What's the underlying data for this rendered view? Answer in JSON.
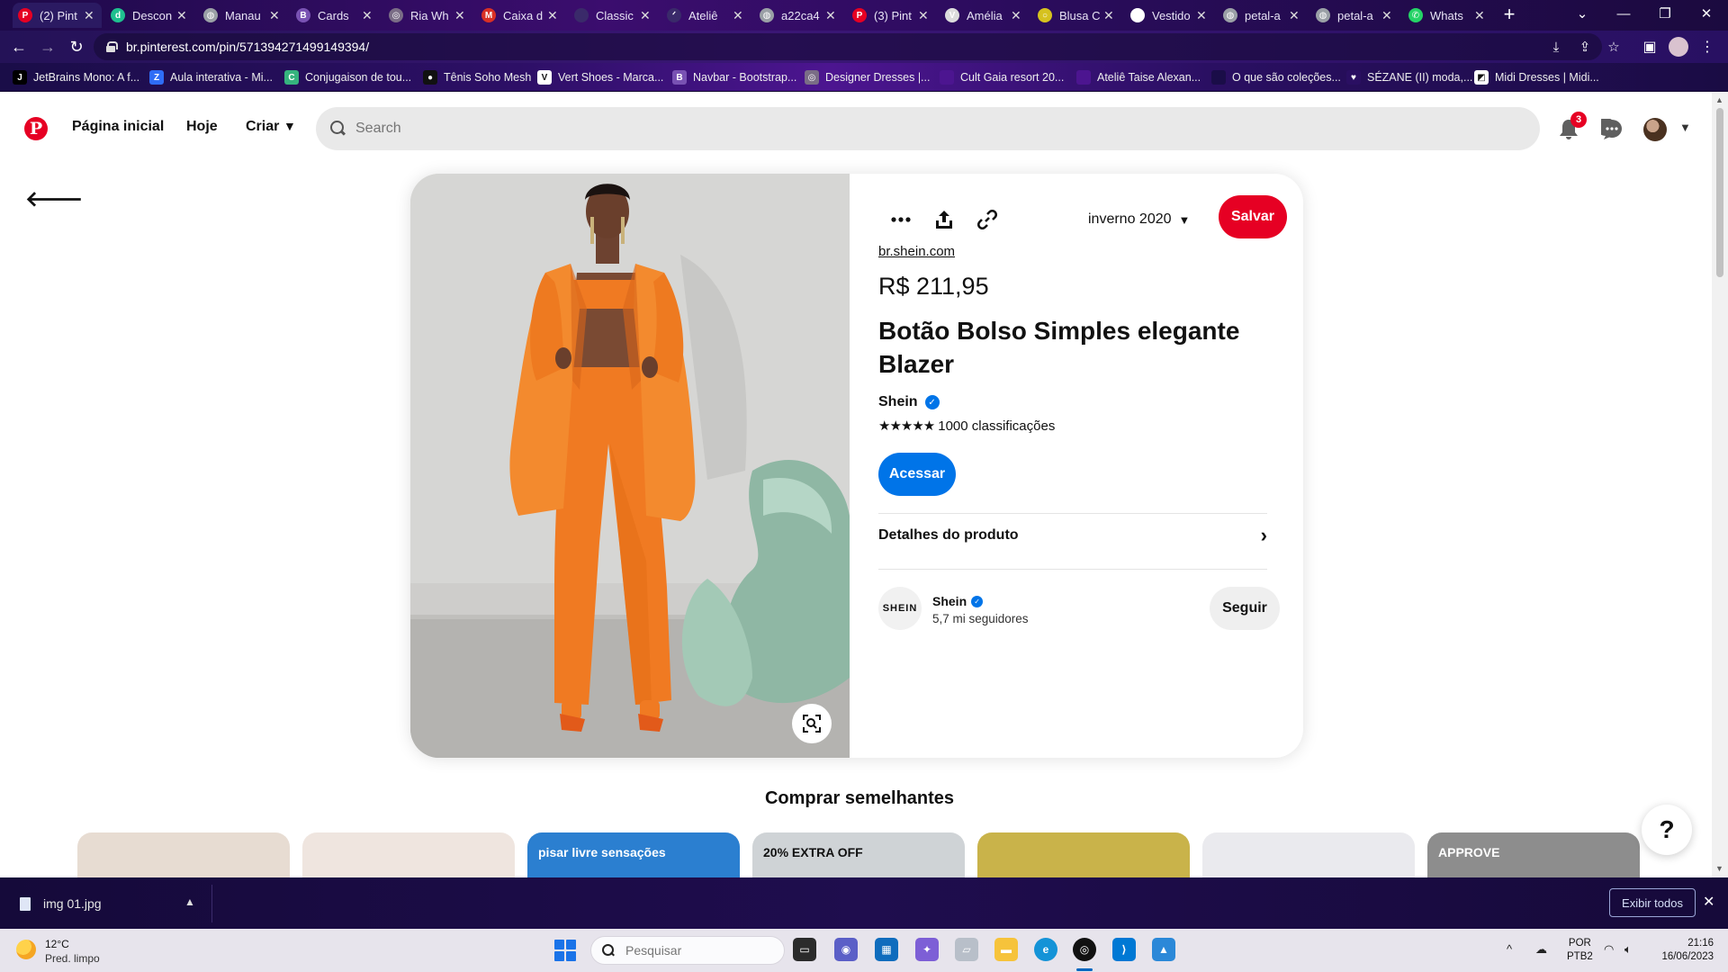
{
  "browser": {
    "tabs": [
      {
        "title": "(2) Pint",
        "favicon": "pinterest-icon",
        "color": "#e60023",
        "glyph": "P",
        "active": true
      },
      {
        "title": "Descon",
        "favicon": "descomplica-icon",
        "color": "#1fbf8f",
        "glyph": "d"
      },
      {
        "title": "Manau",
        "favicon": "globe-icon",
        "color": "#9aa0a6",
        "glyph": "◍"
      },
      {
        "title": "Cards",
        "favicon": "bootstrap-icon",
        "color": "#7952b3",
        "glyph": "B"
      },
      {
        "title": "Ria Wh",
        "favicon": "dribbble-icon",
        "color": "#7a6d86",
        "glyph": "◎"
      },
      {
        "title": "Caixa d",
        "favicon": "gmail-icon",
        "color": "#d93025",
        "glyph": "M"
      },
      {
        "title": "Classic",
        "favicon": "blank-icon",
        "color": "#3a2a6a",
        "glyph": ""
      },
      {
        "title": "Ateliê",
        "favicon": "atelie-icon",
        "color": "#3a2a6a",
        "glyph": "ᐟ"
      },
      {
        "title": "a22ca4",
        "favicon": "globe-icon",
        "color": "#9aa0a6",
        "glyph": "◍"
      },
      {
        "title": "(3) Pint",
        "favicon": "pinterest-icon",
        "color": "#e60023",
        "glyph": "P"
      },
      {
        "title": "Amélia",
        "favicon": "amelia-icon",
        "color": "#dcdcdc",
        "glyph": "V"
      },
      {
        "title": "Blusa C",
        "favicon": "circle-icon",
        "color": "#d6c21f",
        "glyph": "○"
      },
      {
        "title": "Vestido",
        "favicon": "image-icon",
        "color": "#ffffff",
        "glyph": "◩"
      },
      {
        "title": "petal-a",
        "favicon": "globe-icon",
        "color": "#9aa0a6",
        "glyph": "◍"
      },
      {
        "title": "petal-a",
        "favicon": "globe-icon",
        "color": "#9aa0a6",
        "glyph": "◍"
      },
      {
        "title": "Whats",
        "favicon": "whatsapp-icon",
        "color": "#25d366",
        "glyph": "✆"
      }
    ],
    "url": "br.pinterest.com/pin/571394271499149394/",
    "bookmarks": [
      {
        "label": "JetBrains Mono: A f...",
        "color": "#000000",
        "glyph": "J"
      },
      {
        "label": "Aula interativa - Mi...",
        "color": "#2f6df6",
        "glyph": "Z"
      },
      {
        "label": "Conjugaison de tou...",
        "color": "#36b37e",
        "glyph": "C"
      },
      {
        "label": "Tênis Soho Mesh",
        "color": "#111111",
        "glyph": "●"
      },
      {
        "label": "Vert Shoes - Marca...",
        "color": "#ffffff",
        "glyph": "V"
      },
      {
        "label": "Navbar - Bootstrap...",
        "color": "#7952b3",
        "glyph": "B"
      },
      {
        "label": "Designer Dresses |...",
        "color": "#7a6d86",
        "glyph": "◎"
      },
      {
        "label": "Cult Gaia resort 20...",
        "color": "#4c1590",
        "glyph": ""
      },
      {
        "label": "Ateliê Taise Alexan...",
        "color": "#4c1590",
        "glyph": ""
      },
      {
        "label": "O que são coleções...",
        "color": "#1a0d48",
        "glyph": ""
      },
      {
        "label": "SÉZANE (II) moda,...",
        "color": "#2a0f62",
        "glyph": "♥"
      },
      {
        "label": "Midi Dresses | Midi...",
        "color": "#ffffff",
        "glyph": "◩"
      }
    ]
  },
  "header": {
    "nav": [
      "Página inicial",
      "Hoje",
      "Criar"
    ],
    "search_placeholder": "Search",
    "notifications_count": "3"
  },
  "pin": {
    "board": "inverno 2020",
    "save_label": "Salvar",
    "domain": "br.shein.com",
    "price": "R$ 211,95",
    "title": "Botão Bolso Simples elegante Blazer",
    "brand": "Shein",
    "rating_stars": "★★★★★",
    "rating_count": "1000 classificações",
    "visit_label": "Acessar",
    "details_label": "Detalhes do produto",
    "creator": {
      "avatar_text": "SHEIN",
      "name": "Shein",
      "followers": "5,7 mi seguidores",
      "follow_label": "Seguir"
    }
  },
  "shop": {
    "title": "Comprar semelhantes",
    "cards": [
      {
        "overlay": "",
        "bg": "#e7dcd2"
      },
      {
        "overlay": "",
        "bg": "#efe5df"
      },
      {
        "overlay": "pisar livre sensações",
        "bg": "#2b7fd0"
      },
      {
        "overlay": "20% EXTRA OFF",
        "bg": "#cfd3d6"
      },
      {
        "overlay": "",
        "bg": "#c9b34a"
      },
      {
        "overlay": "",
        "bg": "#eaeaee"
      },
      {
        "overlay": "APPROVE",
        "bg": "#8d8d8d"
      }
    ],
    "help_label": "?"
  },
  "downloads": {
    "file": "img 01.jpg",
    "show_all": "Exibir todos"
  },
  "taskbar": {
    "temperature": "12°C",
    "weather": "Pred. limpo",
    "search_placeholder": "Pesquisar",
    "lang_line1": "POR",
    "lang_line2": "PTB2",
    "time": "21:16",
    "date": "16/06/2023"
  },
  "colors": {
    "pinterest_red": "#e60023",
    "visit_blue": "#0074e8",
    "jacket_orange": "#f07a22"
  }
}
